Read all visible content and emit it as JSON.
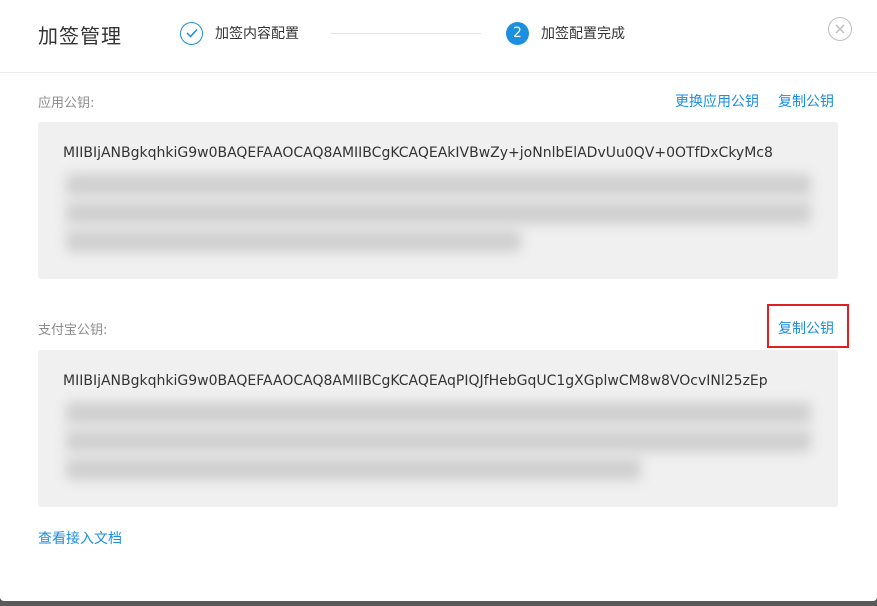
{
  "dialog": {
    "title": "加签管理",
    "close_icon": "close-icon"
  },
  "steps": [
    {
      "label": "加签内容配置",
      "state": "done",
      "icon": "check-icon"
    },
    {
      "label": "加签配置完成",
      "state": "active",
      "number": "2"
    }
  ],
  "app_key": {
    "label": "应用公钥:",
    "replace_link": "更换应用公钥",
    "copy_link": "复制公钥",
    "key_visible": "MIIBIjANBgkqhkiG9w0BAQEFAAOCAQ8AMIIBCgKCAQEAkIVBwZy+joNnlbElADvUu0QV+0OTfDxCkyMc8"
  },
  "alipay_key": {
    "label": "支付宝公钥:",
    "copy_link": "复制公钥",
    "key_visible": "MIIBIjANBgkqhkiG9w0BAQEFAAOCAQ8AMIIBCgKCAQEAqPIQJfHebGqUC1gXGplwCM8w8VOcvINl25zEp"
  },
  "footer": {
    "doc_link": "查看接入文档"
  },
  "colors": {
    "accent": "#1b8fe0",
    "highlight": "#e02020",
    "key_background": "#f0f0f0"
  }
}
